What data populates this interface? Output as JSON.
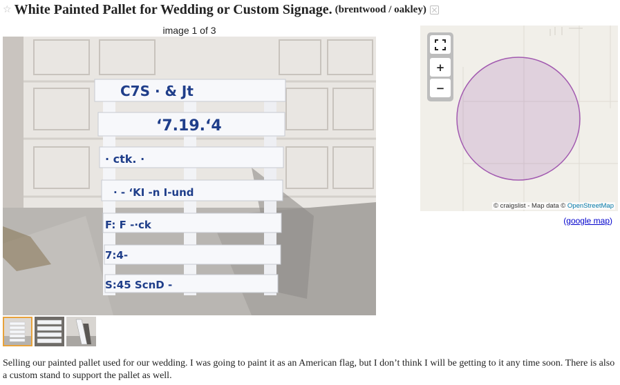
{
  "posting": {
    "title": "White Painted Pallet for Wedding or Custom Signage.",
    "location": "(brentwood / oakley)",
    "star_icon": "star-icon",
    "hide_icon": "hide-icon"
  },
  "gallery": {
    "counter": "image 1 of 3",
    "main_image_alt": "white painted pallet leaning against a garage door",
    "selected_thumb": 1,
    "thumbs": [
      {
        "alt": "pallet front view"
      },
      {
        "alt": "pallet close view"
      },
      {
        "alt": "pallet side view with stand"
      }
    ],
    "pallet_text": {
      "board1": "C7S · & Jt",
      "board2": "‘7.19.‘4",
      "board3": "· ctk.    ·",
      "board4": "· - ‘KI -n      I-und",
      "board5": "F: F       -·ck",
      "board6": "7:4-",
      "board7": "S:45   ScnD -"
    }
  },
  "map": {
    "zoom_controls": {
      "fullscreen_icon": "fullscreen-icon",
      "zoom_in": "+",
      "zoom_out": "−"
    },
    "attribution": "© craigslist - Map data ©",
    "attribution_link": "OpenStreetMap",
    "google_link": "google map",
    "circle_color": "#a25ab0"
  },
  "description": "Selling our painted pallet used for our wedding. I was going to paint it as an American flag, but I don’t think I will be getting to it any time soon. There is also a custom stand to support the pallet as well."
}
